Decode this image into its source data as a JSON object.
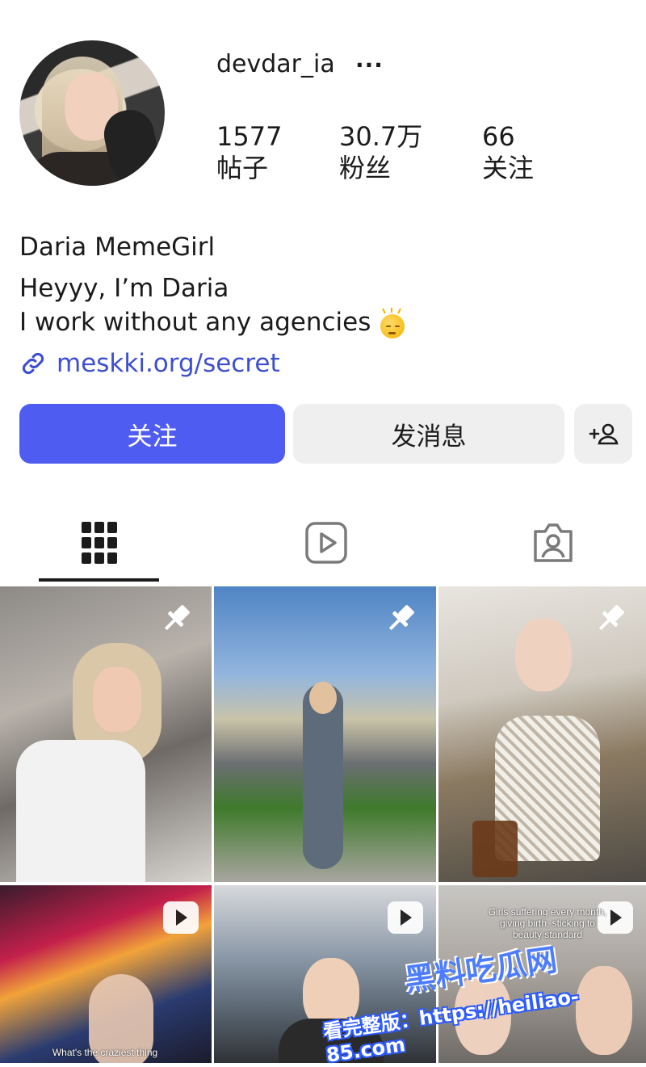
{
  "profile": {
    "username": "devdar_ia",
    "more_icon": "···",
    "stats": [
      {
        "value": "1577",
        "label": "帖子"
      },
      {
        "value": "30.7万",
        "label": "粉丝"
      },
      {
        "value": "66",
        "label": "关注"
      }
    ],
    "display_name": "Daria MemeGirl",
    "bio_line1": "Heyyy, I’m Daria",
    "bio_line2": "I work without any agencies",
    "bio_emoji": "sleepy-sun-emoji",
    "link": "meskki.org/secret"
  },
  "actions": {
    "follow_label": "关注",
    "message_label": "发消息",
    "add_person_icon": "add-person-icon"
  },
  "tabs": [
    {
      "icon": "grid-icon",
      "selected": true
    },
    {
      "icon": "reels-icon",
      "selected": false
    },
    {
      "icon": "tagged-icon",
      "selected": false
    }
  ],
  "posts": [
    {
      "type": "pinned",
      "caption": ""
    },
    {
      "type": "pinned",
      "caption": ""
    },
    {
      "type": "pinned",
      "caption": ""
    },
    {
      "type": "reel",
      "caption": "What's the craziest thing"
    },
    {
      "type": "reel",
      "caption": ""
    },
    {
      "type": "reel",
      "caption": "Girls suffering every month, giving birth, sticking to beauty standard"
    }
  ],
  "watermark": {
    "site_name": "黑料吃瓜网",
    "url_text": "看完整版：https://heiliao-85.com"
  },
  "colors": {
    "accent": "#4f5cf2",
    "link": "#3d4fcf",
    "secondary_button": "#efefef"
  }
}
